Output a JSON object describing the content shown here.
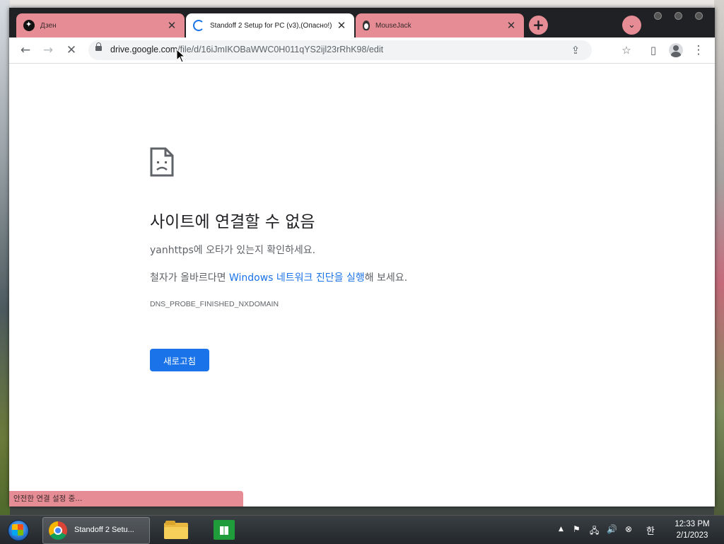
{
  "browser": {
    "tabs": [
      {
        "title": "Дзен",
        "icon": "dzen-icon"
      },
      {
        "title": "Standoff 2 Setup for PC (v3),(Опасно!)",
        "icon": "loading-spinner-icon"
      },
      {
        "title": "MouseJack",
        "icon": "penguin-icon"
      }
    ],
    "active_tab_index": 1,
    "url_host": "drive.google.com",
    "url_path": "/file/d/16iJmIKOBaWWC0H011qYS2ijl23rRhK98/edit"
  },
  "page": {
    "title": "사이트에 연결할 수 없음",
    "line1": "yanhttps에 오타가 있는지 확인하세요.",
    "line2_prefix": "철자가 올바르다면 ",
    "line2_link": "Windows 네트워크 진단을 실행",
    "line2_suffix": "해 보세요.",
    "error_code": "DNS_PROBE_FINISHED_NXDOMAIN",
    "reload_label": "새로고침"
  },
  "status_bar": "안전한 연결 설정 중...",
  "taskbar": {
    "chrome_label": "Standoff 2 Setu...",
    "ime": "한",
    "time": "12:33 PM",
    "date": "2/1/2023"
  },
  "colors": {
    "accent": "#1a73e8",
    "tab_theme": "#e58c94"
  }
}
